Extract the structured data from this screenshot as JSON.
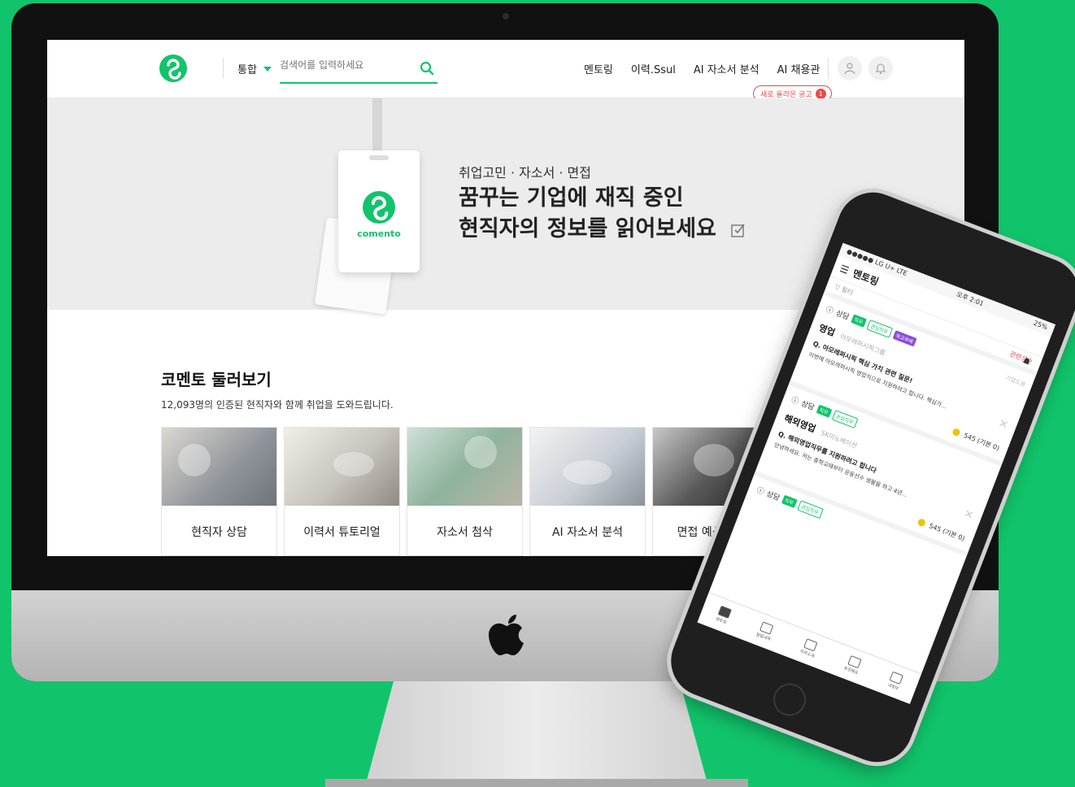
{
  "header": {
    "scope_label": "통합",
    "search_placeholder": "검색어를 입력하세요",
    "nav": [
      "멘토링",
      "이력.Ssul",
      "AI 자소서 분석",
      "AI 채용관"
    ],
    "new_post_label": "새로 올라온 공고",
    "new_post_count": "1"
  },
  "banner": {
    "card_brand": "comento",
    "subtitle": "취업고민 · 자소서 · 면접",
    "title_line1": "꿈꾸는 기업에 재직 중인",
    "title_line2": "현직자의 정보를 읽어보세요"
  },
  "section": {
    "title": "코멘토 둘러보기",
    "subtitle": "12,093명의 인증된 현직자와 함께 취업을 도와드립니다.",
    "cards": [
      {
        "label": "현직자 상담"
      },
      {
        "label": "이력서 튜토리얼"
      },
      {
        "label": "자소서 첨삭"
      },
      {
        "label": "AI 자소서 분석"
      },
      {
        "label": "면접 예상질문"
      }
    ]
  },
  "phone": {
    "carrier": "●●●●● LG U+ LTE",
    "time": "오후 2:01",
    "battery": "25%",
    "app_title": "멘토링",
    "filter_label": "필터",
    "sort_label": "관련성순",
    "posts": [
      {
        "type": "상담",
        "tags": [
          "직무",
          "관심직무",
          "학교후배"
        ],
        "meta": "기업도움",
        "field": "영업",
        "company": "아모레퍼시픽그룹",
        "question": "Q. 아모레퍼시픽 핵심 가치 관련 질문!",
        "body": "이번에 아모레퍼시픽 영업직으로 지원하려고 합니다. 핵심가...",
        "points": "545",
        "points_base": "(기본 0)"
      },
      {
        "type": "상담",
        "tags": [
          "직무",
          "관심직무"
        ],
        "meta": "",
        "field": "해외영업",
        "company": "SK이노베이션",
        "question": "Q. 해외영업직무를 지원하려고 합니다",
        "body": "안녕하세요. 저는 중학교때부터 운동선수 생활을 하고 4년...",
        "points": "545",
        "points_base": "(기본 0)"
      },
      {
        "type": "상담",
        "tags": [
          "직무",
          "관심직무"
        ],
        "meta": "",
        "field": "",
        "company": "",
        "question": "",
        "body": "",
        "points": "",
        "points_base": ""
      }
    ],
    "tabs": [
      "멘토링",
      "알림내역",
      "직무소개",
      "추천해요",
      "내정보"
    ]
  },
  "colors": {
    "brand_green": "#11c46b",
    "alert_red": "#e94b4b",
    "coin_yellow": "#f2c200"
  }
}
